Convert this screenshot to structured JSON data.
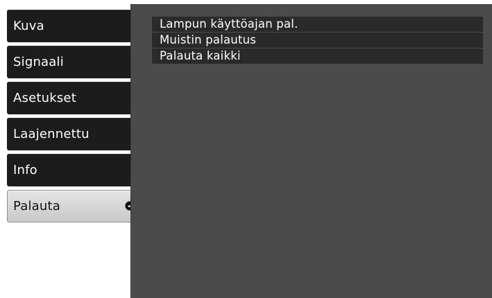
{
  "menu": {
    "items": [
      {
        "label": "Kuva"
      },
      {
        "label": "Signaali"
      },
      {
        "label": "Asetukset"
      },
      {
        "label": "Laajennettu"
      },
      {
        "label": "Info"
      },
      {
        "label": "Palauta",
        "selected": true,
        "icon": "enter-icon"
      }
    ]
  },
  "submenu": {
    "items": [
      {
        "label": "Lampun käyttöajan pal."
      },
      {
        "label": "Muistin palautus"
      },
      {
        "label": "Palauta kaikki"
      }
    ]
  },
  "colors": {
    "menu_bg": "#1c1c1c",
    "panel_bg": "#4b4b4b",
    "selected_bg": "#d6d6d6",
    "text": "#ffffff"
  }
}
